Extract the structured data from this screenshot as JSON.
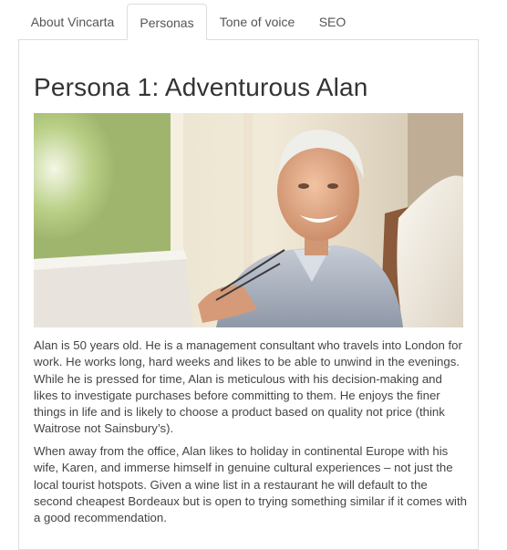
{
  "tabs": [
    {
      "label": "About Vincarta",
      "active": false
    },
    {
      "label": "Personas",
      "active": true
    },
    {
      "label": "Tone of voice",
      "active": false
    },
    {
      "label": "SEO",
      "active": false
    }
  ],
  "persona": {
    "title": "Persona 1: Adventurous Alan",
    "paragraphs": [
      "Alan is 50 years old. He is a management consultant who travels into London for work. He works long, hard weeks and likes to be able to unwind in the evenings. While he is pressed for time, Alan is meticulous with his decision-making and likes to investigate purchases before committing to them. He enjoys the finer things in life and is likely to choose a product based on quality not price (think Waitrose not Sainsbury’s).",
      "When away from the office, Alan likes to holiday in continental Europe with his wife, Karen, and immerse himself in genuine cultural experiences – not just the local tourist hotspots. Given a wine list in a restaurant he will default to the second cheapest Bordeaux but is open to trying something similar if it comes with a good recommendation."
    ]
  },
  "colors": {
    "tab_border": "#dddddd",
    "text": "#444444",
    "title": "#333333"
  }
}
